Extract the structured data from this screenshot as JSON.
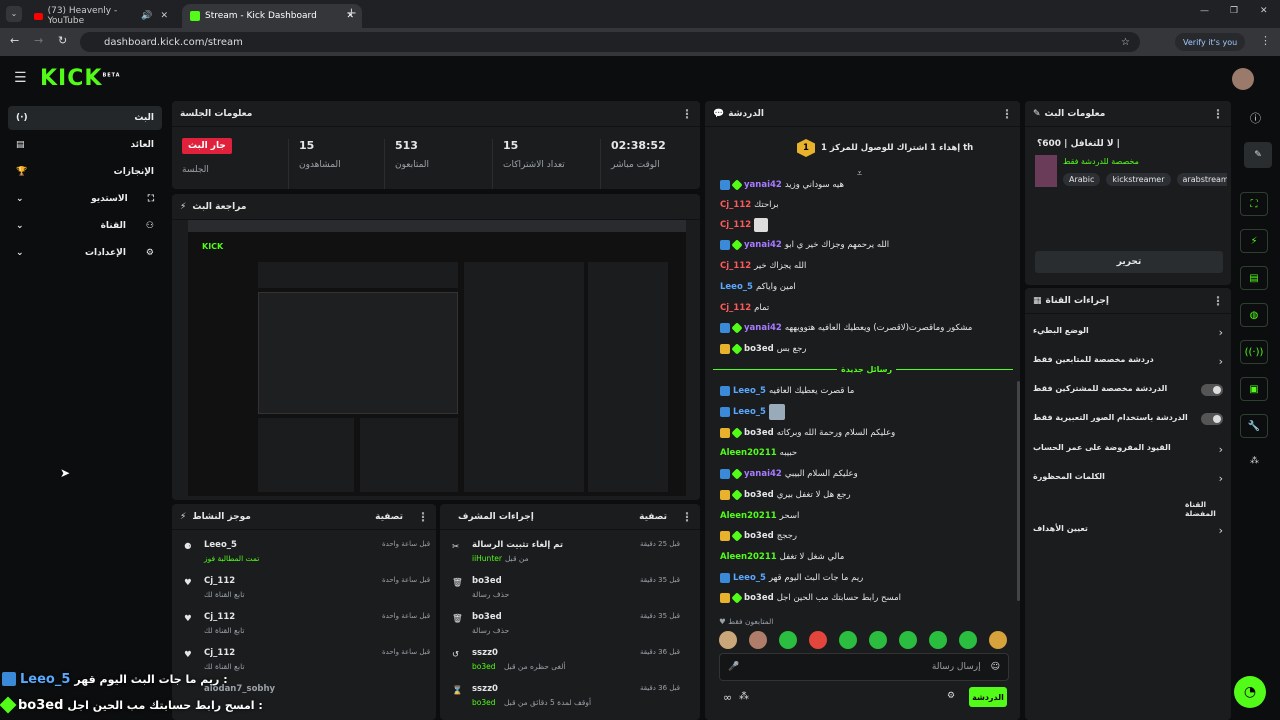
{
  "browser": {
    "tabs": [
      {
        "label": "(73) Heavenly - YouTube"
      },
      {
        "label": "Stream - Kick Dashboard"
      }
    ],
    "url": "dashboard.kick.com/stream",
    "verify_label": "Verify it's you"
  },
  "brand": {
    "logo": "KICK",
    "beta": "BETA",
    "accent": "#53fc18"
  },
  "sidebar": {
    "items": [
      {
        "label": "البث",
        "icon": "live-icon"
      },
      {
        "label": "العائد",
        "icon": "revenue-icon"
      },
      {
        "label": "الإنجازات",
        "icon": "trophy-icon"
      },
      {
        "label": "الاستديو",
        "icon": "studio-icon"
      },
      {
        "label": "القناة",
        "icon": "channel-icon"
      },
      {
        "label": "الإعدادات",
        "icon": "gear-icon"
      }
    ]
  },
  "session": {
    "title": "معلومات الجلسة",
    "live_badge": "جار البث",
    "live_caption": "الجلسة",
    "stats": [
      {
        "value": "15",
        "label": "المشاهدون"
      },
      {
        "value": "513",
        "label": "المتابعون"
      },
      {
        "value": "15",
        "label": "تعداد الاشتراكات"
      },
      {
        "value": "02:38:52",
        "label": "الوقت مباشر"
      }
    ]
  },
  "preview": {
    "title": "مراجعة البث"
  },
  "activity": {
    "title": "موجز النشاط",
    "filter": "تصفية",
    "items": [
      {
        "user": "Leeo_5",
        "desc": "تمت المطالبة فوز",
        "time": "قبل ساعة واحدة"
      },
      {
        "user": "Cj_112",
        "desc": "تابع القناة لك",
        "time": "قبل ساعة واحدة"
      },
      {
        "user": "Cj_112",
        "desc": "تابع القناة لك",
        "time": "قبل ساعة واحدة"
      },
      {
        "user": "Cj_112",
        "desc": "تابع القناة لك",
        "time": "قبل ساعة واحدة"
      },
      {
        "user": "alodan7_sobhy",
        "desc": "",
        "time": ""
      }
    ]
  },
  "modactions": {
    "title": "إجراءات المشرف",
    "filter": "تصفية",
    "items": [
      {
        "title": "تم إلغاء تثبيت الرسالة",
        "desc": "من قبل",
        "actor": "iiHunter",
        "time": "قبل 25 دقيقة"
      },
      {
        "title": "bo3ed",
        "desc": "حذف رسالة",
        "actor": "",
        "time": "قبل 35 دقيقة"
      },
      {
        "title": "bo3ed",
        "desc": "حذف رسالة",
        "actor": "",
        "time": "قبل 35 دقيقة"
      },
      {
        "title": "sszz0",
        "desc": "ألغى حظره من قبل",
        "actor": "bo3ed",
        "time": "قبل 36 دقيقة"
      },
      {
        "title": "sszz0",
        "desc": "أوقف لمدة 5 دقائق من قبل",
        "actor": "bo3ed",
        "time": "قبل 36 دقيقة"
      }
    ]
  },
  "chat": {
    "title": "الدردشة",
    "pinned": "إهداء 1 اشتراك للوصول للمركز 1 th",
    "pinned_rank": "1",
    "new_messages": "رسائل جديدة",
    "followers_only": "المتابعون فقط",
    "input_placeholder": "إرسال رسالة",
    "send_label": "الدردشة",
    "messages": [
      {
        "user": "yanai42",
        "text": "هيه سوداني وزيد",
        "color": "#a77bff"
      },
      {
        "user": "Cj_112",
        "text": "براحتك",
        "color": "#ff5a5a"
      },
      {
        "user": "Cj_112",
        "text": "",
        "color": "#ff5a5a"
      },
      {
        "user": "yanai42",
        "text": "الله يرحمهم وجزاك خير ي ابو",
        "color": "#a77bff"
      },
      {
        "user": "Cj_112",
        "text": "الله يجزاك خير",
        "color": "#ff5a5a"
      },
      {
        "user": "Leeo_5",
        "text": "امين واياكم",
        "color": "#5aa9ff"
      },
      {
        "user": "Cj_112",
        "text": "تمام",
        "color": "#ff5a5a"
      },
      {
        "user": "yanai42",
        "text": "مشكور وماقصرت(لاقصرت) ويعطيك العافيه هتوويههه",
        "color": "#a77bff"
      },
      {
        "user": "bo3ed",
        "text": "رجع بس",
        "color": "#ffffff"
      },
      {
        "user": "Leeo_5",
        "text": "ما قصرت يعطيك العافيه",
        "color": "#5aa9ff"
      },
      {
        "user": "Leeo_5",
        "text": "",
        "color": "#5aa9ff"
      },
      {
        "user": "bo3ed",
        "text": "وعليكم السلام ورحمة الله وبركاته",
        "color": "#ffffff"
      },
      {
        "user": "Aleen20211",
        "text": "حبيبه",
        "color": "#53fc18"
      },
      {
        "user": "yanai42",
        "text": "وعليكم السلام البيبي",
        "color": "#a77bff"
      },
      {
        "user": "bo3ed",
        "text": "رجع هل لا تغفل بيري",
        "color": "#ffffff"
      },
      {
        "user": "Aleen20211",
        "text": "اسحر",
        "color": "#53fc18"
      },
      {
        "user": "bo3ed",
        "text": "رججج",
        "color": "#ffffff"
      },
      {
        "user": "Aleen20211",
        "text": "مالي شغل لا تغفل",
        "color": "#53fc18"
      },
      {
        "user": "Leeo_5",
        "text": "ريم ما جات البث اليوم قهر",
        "color": "#5aa9ff"
      },
      {
        "user": "bo3ed",
        "text": "امسح رابط حسابتك مب الحين اجل",
        "color": "#ffffff"
      }
    ]
  },
  "streaminfo": {
    "title": "معلومات البث",
    "stream_title": "لا للتغافل | 600؟ |",
    "category": "مخصصة للدردشة فقط",
    "tags": [
      "Arabic",
      "kickstreamer",
      "arabstreame"
    ],
    "edit_label": "تحرير"
  },
  "channelactions": {
    "title": "إجراءات القناة",
    "items": [
      {
        "label": "الوضع البطيء",
        "control": "chevron"
      },
      {
        "label": "دردشة مخصصة للمتابعين فقط",
        "control": "chevron"
      },
      {
        "label": "الدردشة مخصصة للمشتركين فقط",
        "control": "toggle"
      },
      {
        "label": "الدردشة باستخدام الصور التعبيرية فقط",
        "control": "toggle"
      },
      {
        "label": "القيود المفروضة على عمر الحساب",
        "control": "chevron"
      },
      {
        "label": "الكلمات المحظورة",
        "control": "chevron"
      }
    ],
    "favorite_channel": "القناة المفضلة",
    "goals": "تعيين الأهداف"
  },
  "overlay": [
    {
      "user": "Leeo_5",
      "text": "ريم ما جات البث اليوم قهر :"
    },
    {
      "user": "bo3ed",
      "text": "امسح رابط حسابتك مب الحين اجل :"
    }
  ]
}
